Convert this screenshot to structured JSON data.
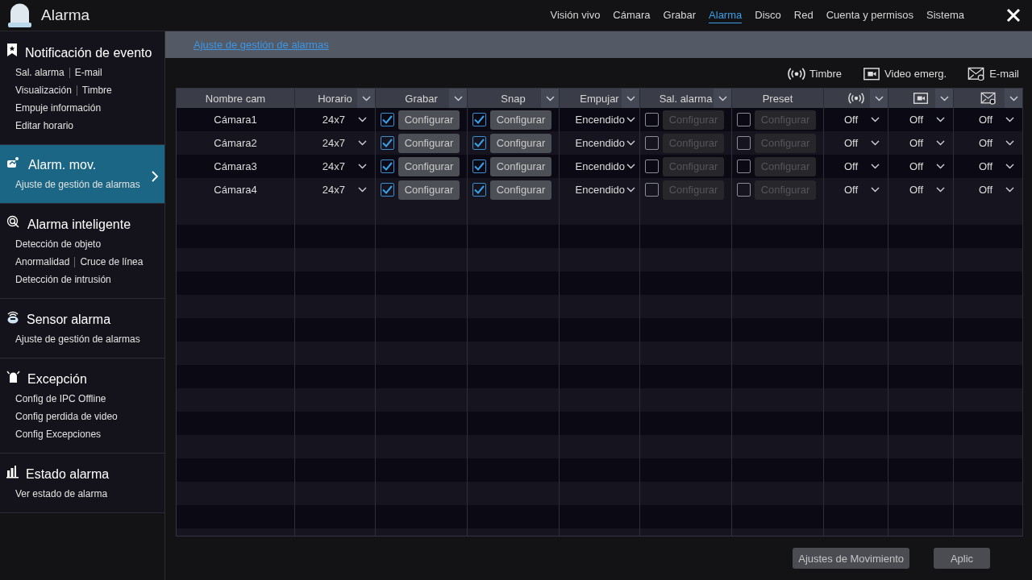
{
  "window": {
    "title": "Alarma"
  },
  "nav": [
    {
      "label": "Visión vivo",
      "selected": false
    },
    {
      "label": "Cámara",
      "selected": false
    },
    {
      "label": "Grabar",
      "selected": false
    },
    {
      "label": "Alarma",
      "selected": true
    },
    {
      "label": "Disco",
      "selected": false
    },
    {
      "label": "Red",
      "selected": false
    },
    {
      "label": "Cuenta y permisos",
      "selected": false
    },
    {
      "label": "Sistema",
      "selected": false
    }
  ],
  "sidebar": {
    "sections": [
      {
        "kind": "bookmark",
        "title": "Notificación de evento",
        "selected": false,
        "links": [
          [
            "Sal. alarma",
            "E-mail"
          ],
          [
            "Visualización",
            "Timbre"
          ],
          [
            "Empuje información"
          ],
          [
            "Editar horario"
          ]
        ]
      },
      {
        "kind": "motion",
        "title": "Alarm. mov.",
        "selected": true,
        "links": [
          [
            "Ajuste de gestión de alarmas"
          ]
        ]
      },
      {
        "kind": "target",
        "title": "Alarma inteligente",
        "selected": false,
        "links": [
          [
            "Detección de objeto"
          ],
          [
            "Anormalidad",
            "Cruce de línea"
          ],
          [
            "Detección de intrusión"
          ]
        ]
      },
      {
        "kind": "sensor",
        "title": "Sensor alarma",
        "selected": false,
        "links": [
          [
            "Ajuste de gestión de alarmas"
          ]
        ]
      },
      {
        "kind": "siren",
        "title": "Excepción",
        "selected": false,
        "links": [
          [
            "Config de IPC Offline"
          ],
          [
            "Config perdida de video"
          ],
          [
            "Config Excepciones"
          ]
        ]
      },
      {
        "kind": "status",
        "title": "Estado alarma",
        "selected": false,
        "links": [
          [
            "Ver estado de alarma"
          ]
        ]
      }
    ]
  },
  "breadcrumb": "Ajuste de gestión de alarmas",
  "legend": [
    {
      "kind": "buzzer",
      "label": "Timbre"
    },
    {
      "kind": "video",
      "label": "Video emerg."
    },
    {
      "kind": "email",
      "label": "E-mail"
    }
  ],
  "table": {
    "columns": [
      {
        "kind": "text",
        "label": "Nombre cam",
        "menu": false
      },
      {
        "kind": "text",
        "label": "Horario",
        "menu": true
      },
      {
        "kind": "text",
        "label": "Grabar",
        "menu": true
      },
      {
        "kind": "text",
        "label": "Snap",
        "menu": true
      },
      {
        "kind": "text",
        "label": "Empujar",
        "menu": true
      },
      {
        "kind": "text",
        "label": "Sal. alarma",
        "menu": true
      },
      {
        "kind": "text",
        "label": "Preset",
        "menu": false
      },
      {
        "kind": "buzzer",
        "menu": true
      },
      {
        "kind": "video",
        "menu": true
      },
      {
        "kind": "email",
        "menu": true
      }
    ],
    "rows": [
      {
        "name": "Cámara1",
        "schedule": "24x7",
        "record": {
          "checked": true,
          "button": "Configurar"
        },
        "snap": {
          "checked": true,
          "button": "Configurar"
        },
        "push": "Encendido",
        "alarm_out": {
          "checked": false,
          "button": "Configurar"
        },
        "preset": {
          "checked": false,
          "button": "Configurar"
        },
        "buzzer": "Off",
        "video": "Off",
        "email": "Off"
      },
      {
        "name": "Cámara2",
        "schedule": "24x7",
        "record": {
          "checked": true,
          "button": "Configurar"
        },
        "snap": {
          "checked": true,
          "button": "Configurar"
        },
        "push": "Encendido",
        "alarm_out": {
          "checked": false,
          "button": "Configurar"
        },
        "preset": {
          "checked": false,
          "button": "Configurar"
        },
        "buzzer": "Off",
        "video": "Off",
        "email": "Off"
      },
      {
        "name": "Cámara3",
        "schedule": "24x7",
        "record": {
          "checked": true,
          "button": "Configurar"
        },
        "snap": {
          "checked": true,
          "button": "Configurar"
        },
        "push": "Encendido",
        "alarm_out": {
          "checked": false,
          "button": "Configurar"
        },
        "preset": {
          "checked": false,
          "button": "Configurar"
        },
        "buzzer": "Off",
        "video": "Off",
        "email": "Off"
      },
      {
        "name": "Cámara4",
        "schedule": "24x7",
        "record": {
          "checked": true,
          "button": "Configurar"
        },
        "snap": {
          "checked": true,
          "button": "Configurar"
        },
        "push": "Encendido",
        "alarm_out": {
          "checked": false,
          "button": "Configurar"
        },
        "preset": {
          "checked": false,
          "button": "Configurar"
        },
        "buzzer": "Off",
        "video": "Off",
        "email": "Off"
      }
    ]
  },
  "buttons": [
    "Ajustes de Movimiento",
    "Aplic"
  ]
}
